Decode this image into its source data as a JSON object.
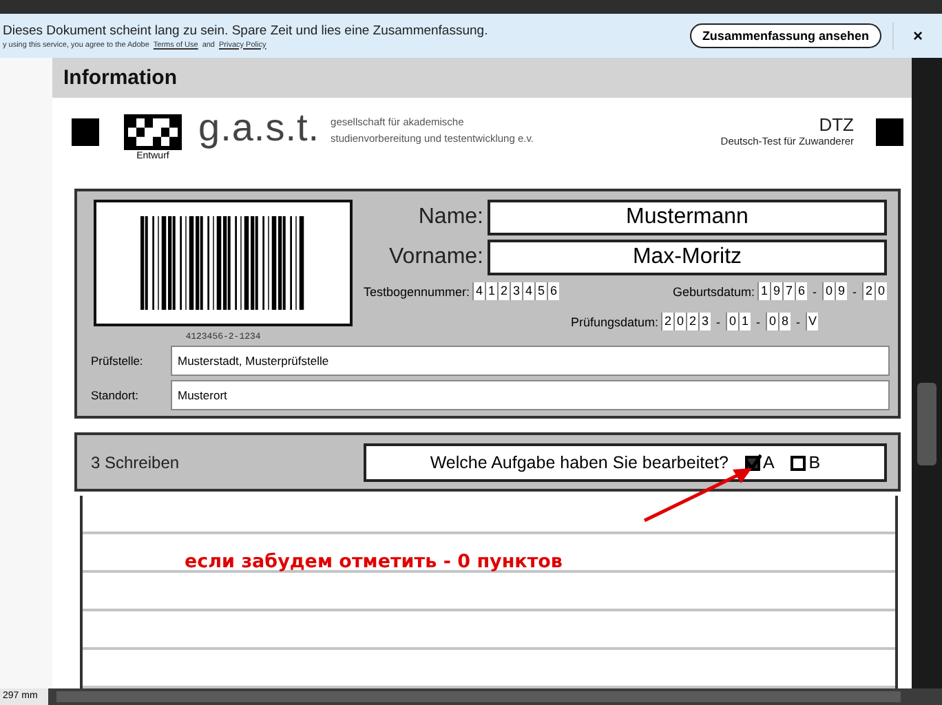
{
  "banner": {
    "message": "Dieses Dokument scheint lang zu sein. Spare Zeit und lies eine Zusammenfassung.",
    "legal_prefix": "y using this service, you agree to the Adobe",
    "links": [
      {
        "label": "Terms of Use"
      },
      {
        "label": "Privacy Policy"
      }
    ],
    "legal_joiner": "and",
    "button": "Zusammenfassung ansehen",
    "close": "×"
  },
  "section_title": "Information",
  "header": {
    "logo_caption": "Entwurf",
    "brand": "g.a.s.t.",
    "tagline": [
      "gesellschaft für akademische",
      "studienvorbereitung und testentwicklung e.v."
    ],
    "test_code": "DTZ",
    "test_name": "Deutsch-Test für Zuwanderer"
  },
  "form": {
    "barcode_number": "4123456-2-1234",
    "big_fields": [
      {
        "label": "Name:",
        "value": "Mustermann"
      },
      {
        "label": "Vorname:",
        "value": "Max-Moritz"
      }
    ],
    "comb_rows": [
      [
        {
          "label": "Testbogennummer:",
          "groups": [
            [
              "4",
              "1",
              "2",
              "3",
              "4",
              "5",
              "6"
            ]
          ]
        },
        {
          "label": "Geburtsdatum:",
          "groups": [
            [
              "1",
              "9",
              "7",
              "6"
            ],
            [
              "0",
              "9"
            ],
            [
              "2",
              "0"
            ]
          ]
        }
      ],
      [
        {
          "label": "Prüfungsdatum:",
          "groups": [
            [
              "2",
              "0",
              "2",
              "3"
            ],
            [
              "0",
              "1"
            ],
            [
              "0",
              "8"
            ],
            [
              "V"
            ]
          ]
        }
      ]
    ],
    "separator": "-",
    "small_fields": [
      {
        "label": "Prüfstelle:",
        "value": "Musterstadt, Musterprüfstelle"
      },
      {
        "label": "Standort:",
        "value": "Musterort"
      }
    ]
  },
  "writing": {
    "title": "3 Schreiben",
    "question": "Welche Aufgabe haben Sie bearbeitet?",
    "options": [
      {
        "label": "A",
        "checked": true
      },
      {
        "label": "B",
        "checked": false
      }
    ]
  },
  "annotation": "если забудем отметить - 0 пунктов",
  "status_bar": {
    "page_size": "297 mm"
  }
}
